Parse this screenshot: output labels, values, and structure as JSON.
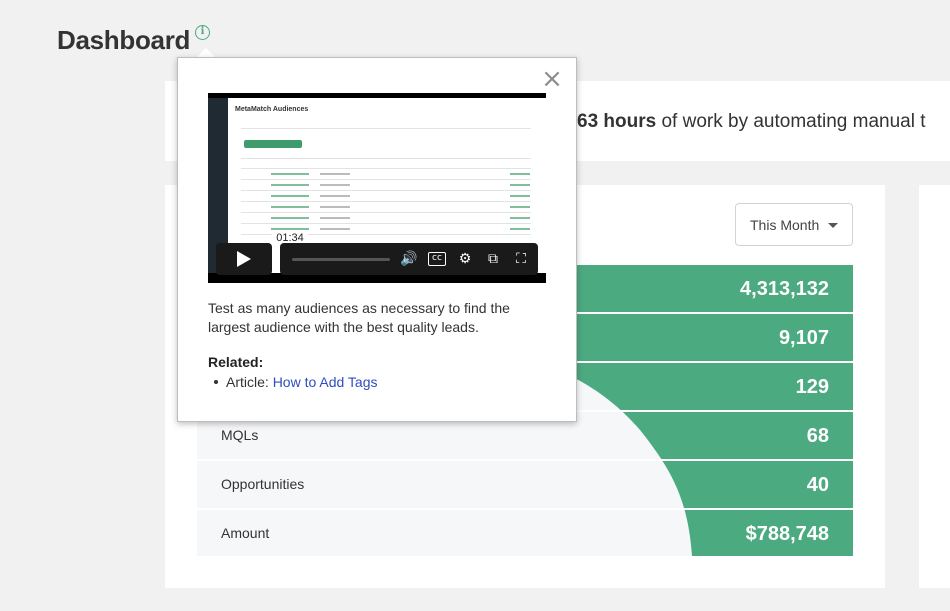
{
  "header": {
    "title": "Dashboard"
  },
  "banner": {
    "hours_bold": "63 hours",
    "hours_rest": " of work by automating manual t"
  },
  "filter": {
    "selected": "This Month"
  },
  "funnel": {
    "rows": [
      {
        "label": "",
        "value": "4,313,132"
      },
      {
        "label": "",
        "value": "9,107"
      },
      {
        "label": "",
        "value": "129"
      },
      {
        "label": "MQLs",
        "value": "68"
      },
      {
        "label": "Opportunities",
        "value": "40"
      },
      {
        "label": "Amount",
        "value": "$788,748"
      }
    ]
  },
  "popup": {
    "video_title": "MetaMatch Audiences",
    "video_time": "01:34",
    "description": "Test as many audiences as necessary to find the largest audience with the best quality leads.",
    "related_heading": "Related:",
    "related_prefix": "Article: ",
    "related_link": "How to Add Tags"
  },
  "colors": {
    "accent": "#4aaa80",
    "row_gray": "#f6f7f9",
    "link": "#2e4ebf"
  }
}
